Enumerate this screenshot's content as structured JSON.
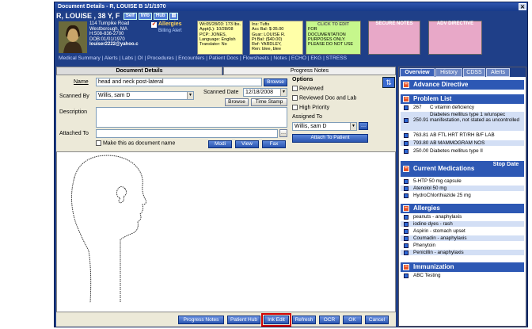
{
  "window": {
    "title": "Document Details - R, LOUISE B 1/1/1970",
    "close": "✕"
  },
  "patient": {
    "name": "R, LOUISE , 38 Y, F",
    "badges": [
      "Self",
      "Info",
      "Hub",
      "▤"
    ],
    "address": [
      "114 Turnpike Road",
      "Westborough, MA",
      "H:508-836-2700",
      "DOB:01/01/1970",
      "louiser2222@yahoo.c"
    ],
    "allergies_label": "Allergies",
    "billing_label": "Billing Alert"
  },
  "vitals": [
    "Wt:05/28/03: 173 lbs.",
    "Appt(L): 10/28/08",
    "PCP: JONES,",
    "Language: English",
    "Translator: No"
  ],
  "insurance": [
    "Ins: Tufts",
    "Acc Bal: $-35.00",
    "Guar: LOUISE R.",
    "Pt Bal: ($40.00)",
    "Ref: YARDLEY,",
    "Ren: blee, blee"
  ],
  "notes_box": {
    "header": "CLICK TO EDIT",
    "lines": [
      "FOR",
      "DOCUMENTATION",
      "PURPOSES ONLY.",
      "PLEASE DO NOT USE"
    ]
  },
  "secure_notes": "SECURE NOTES",
  "adv_directive": "ADV DIRECTIVE",
  "menu": "Medical Summary | Alerts | Labs | OI | Procedures | Encounters | Patient Docs | Flowsheets | Notes | ECHO | EKG | STRESS",
  "tabs": {
    "doc_details": "Document Details",
    "progress_notes": "Progress Notes"
  },
  "form": {
    "name_label": "Name",
    "name_value": "head and neck post-lateral",
    "browse": "Browse",
    "scanned_by_label": "Scanned By",
    "scanned_by_value": "Willis, sam D",
    "scanned_date_label": "Scanned Date",
    "scanned_date_value": "12/18/2008",
    "browse2": "Browse",
    "time_stamp": "Time Stamp",
    "description_label": "Description",
    "attached_to_label": "Attached To",
    "make_doc_name": "Make this as document name",
    "modi": "Modi",
    "view": "View",
    "fax": "Fax"
  },
  "options": {
    "title": "Options",
    "reviewed": "Reviewed",
    "reviewed_doc_lab": "Reviewed Doc and Lab",
    "high_priority": "High Priority",
    "assigned_to_label": "Assigned To",
    "assigned_to_value": "Willis, sam D",
    "attach": "Attach To Patient"
  },
  "bottom_buttons": [
    "Progress Notes",
    "Patient Hub",
    "Ink Edit",
    "Refresh",
    "OCR",
    "OK",
    "Cancel"
  ],
  "right_tabs": [
    "Overview",
    "History",
    "CDSS",
    "Alerts"
  ],
  "right_panel": {
    "advance_directive": "Advance Directive",
    "problem_list": "Problem List",
    "problems": [
      {
        "code": "267",
        "desc": "C vitamin deficiency"
      },
      {
        "code": "250.91",
        "desc": "Diabetes mellitus type 1 w/unspec manifestation, not stated as uncontrolled"
      },
      {
        "code": "763.81",
        "desc": "AB FTL HRT RT/RH B/F LAB"
      },
      {
        "code": "793.80",
        "desc": "AB MAMMOGRAM NOS"
      },
      {
        "code": "250.00",
        "desc": "Diabetes mellitus type II"
      }
    ],
    "current_meds": "Current Medications",
    "stop_date": "Stop Date",
    "meds": [
      "5-HTP 50 mg capsule",
      "Atenolol 50 mg",
      "HydroChlorthiazide 25 mg"
    ],
    "allergies": "Allergies",
    "allergy_items": [
      "peanuts - anaphylaxis",
      "iodine dyes - rash",
      "Aspirin - stomach upset",
      "Coumadin - anaphylaxis",
      "Phenytoin",
      "Penicillin - anaphylaxis"
    ],
    "immunization": "Immunization",
    "immunizations": [
      "ABC Testing"
    ]
  },
  "colors": {
    "window_blue": "#1f3f88",
    "section_blue": "#2d58b4",
    "highlight_red": "#d00000"
  }
}
